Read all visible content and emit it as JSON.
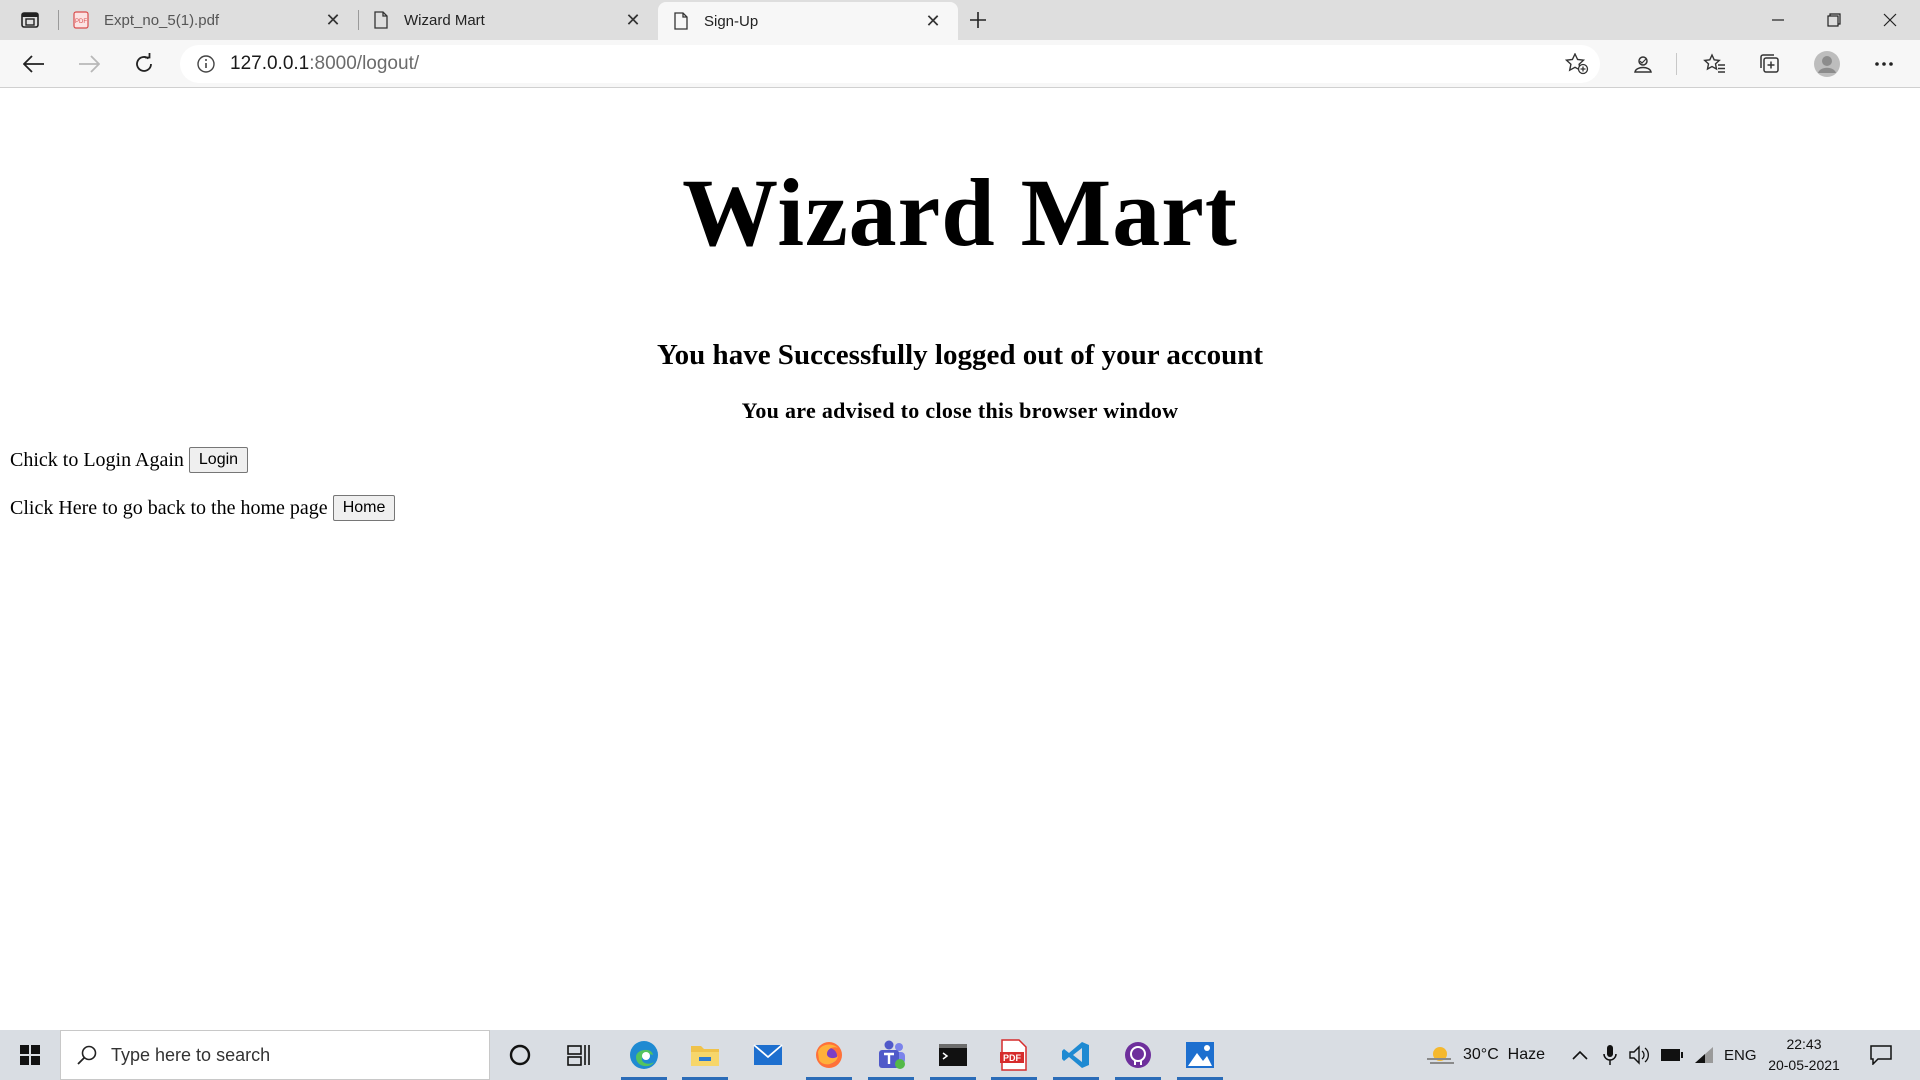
{
  "browser": {
    "tabs": [
      {
        "title": "Expt_no_5(1).pdf",
        "icon": "pdf-icon",
        "active": false
      },
      {
        "title": "Wizard Mart",
        "icon": "page-icon",
        "active": false
      },
      {
        "title": "Sign-Up",
        "icon": "page-icon",
        "active": true
      }
    ],
    "address": {
      "host": "127.0.0.1",
      "path": ":8000/logout/"
    }
  },
  "page": {
    "site_title": "Wizard Mart",
    "message_main": "You have Successfully logged out of your account",
    "message_sub": "You are advised to close this browser window",
    "login_text": "Chick to Login Again",
    "login_button": "Login",
    "home_text": "Click Here to go back to the home page",
    "home_button": "Home"
  },
  "taskbar": {
    "search_placeholder": "Type here to search",
    "apps": [
      "cortana-icon",
      "task-view-icon",
      "edge-icon",
      "file-explorer-icon",
      "mail-icon",
      "firefox-icon",
      "teams-icon",
      "terminal-icon",
      "pdf-reader-icon",
      "vscode-icon",
      "github-desktop-icon",
      "photos-icon"
    ],
    "weather": "30°C  Haze",
    "language": "ENG",
    "time": "22:43",
    "date": "20-05-2021"
  },
  "colors": {
    "tabstrip": "#dedede",
    "toolbar": "#f7f7f7",
    "taskbar": "#d9dde3",
    "accent": "#2b6cb8"
  }
}
